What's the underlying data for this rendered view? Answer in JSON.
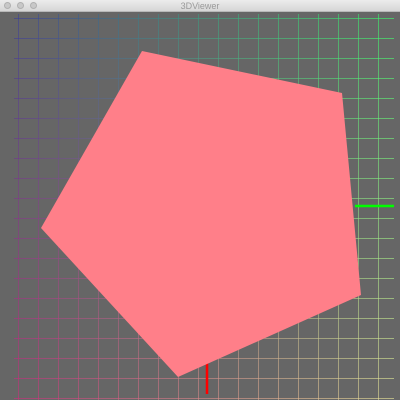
{
  "window": {
    "title": "3DViewer",
    "controls": [
      "close",
      "minimize",
      "maximize"
    ]
  },
  "scene": {
    "background": "#666666",
    "shape": {
      "type": "pentagon",
      "fill": "#ff7f89"
    },
    "axes": {
      "x_color": "#00ff00",
      "y_color": "#ff0000"
    },
    "grid": {
      "visible": true,
      "colors": {
        "top_left": "#3a3a9a",
        "top_right": "#3aff6a",
        "bottom_left": "#c8287a",
        "bottom_right": "#e8e89a"
      }
    }
  }
}
